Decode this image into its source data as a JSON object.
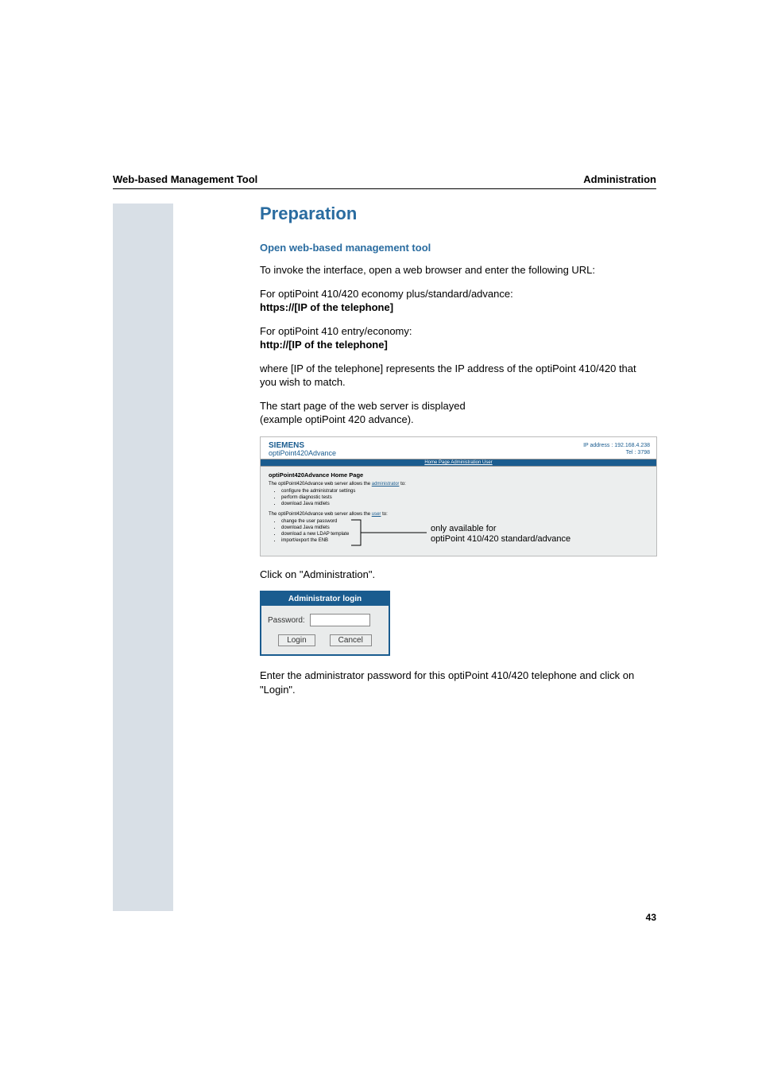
{
  "header": {
    "left": "Web-based Management Tool",
    "right": "Administration"
  },
  "section_title": "Preparation",
  "sub1": "Open web-based management tool",
  "para1": "To invoke the interface, open a web browser and enter the following URL:",
  "para2a": "For optiPoint 410/420 economy plus/standard/advance:",
  "para2b": "https://[IP of the telephone]",
  "para3a": "For optiPoint 410 entry/economy:",
  "para3b": "http://[IP of the telephone]",
  "para4": "where [IP of the telephone] represents the IP address of the optiPoint 410/420 that you wish to match.",
  "para5a": "The start page of the web server is displayed",
  "para5b": "(example optiPoint 420 advance).",
  "shot1": {
    "brand1": "SIEMENS",
    "brand2": "optiPoint420Advance",
    "ip_line1": "IP address : 192.168.4.238",
    "ip_line2": "Tel : 3798",
    "navbar": "Home Page Administration User",
    "body_title": "optiPoint420Advance Home Page",
    "admin_line_pre": "The optiPoint420Advance web server allows the ",
    "admin_link": "administrator",
    "admin_line_post": " to:",
    "admin_items": [
      "configure the administrator settings",
      "perform diagnostic tests",
      "download Java midlets"
    ],
    "user_line_pre": "The optiPoint420Advance web server allows the ",
    "user_link": "user",
    "user_line_post": " to:",
    "user_items": [
      "change the user password",
      "download Java midlets",
      "download a new LDAP template",
      "import/export the ENB"
    ]
  },
  "annotation": {
    "l1": "only available for",
    "l2": "optiPoint 410/420 standard/advance"
  },
  "para6": "Click on \"Administration\".",
  "login": {
    "title": "Administrator login",
    "label": "Password:",
    "value": "",
    "btn_login": "Login",
    "btn_cancel": "Cancel"
  },
  "para7": "Enter the administrator password for this optiPoint 410/420 telephone and click on \"Login\".",
  "page_number": "43"
}
